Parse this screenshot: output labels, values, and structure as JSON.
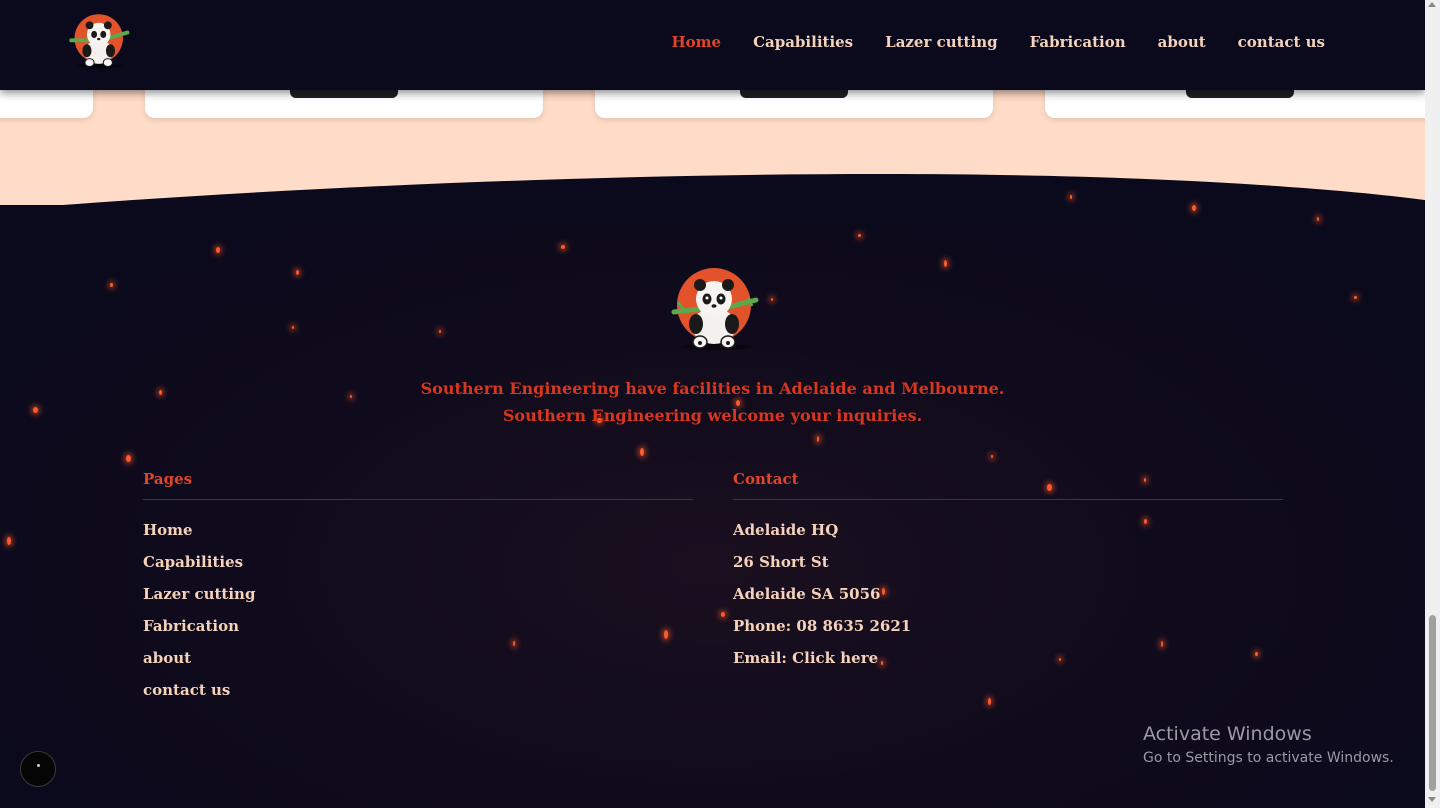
{
  "nav": {
    "items": [
      {
        "label": "Home",
        "active": true
      },
      {
        "label": "Capabilities",
        "active": false
      },
      {
        "label": "Lazer cutting",
        "active": false
      },
      {
        "label": "Fabrication",
        "active": false
      },
      {
        "label": "about",
        "active": false
      },
      {
        "label": "contact us",
        "active": false
      }
    ]
  },
  "footer": {
    "tagline": "Southern Engineering have facilities in Adelaide and Melbourne. Southern Engineering welcome your inquiries.",
    "pages": {
      "title": "Pages",
      "links": [
        "Home",
        "Capabilities",
        "Lazer cutting",
        "Fabrication",
        "about",
        "contact us"
      ]
    },
    "contact": {
      "title": "Contact",
      "lines": [
        "Adelaide HQ",
        "26 Short St",
        "Adelaide SA 5056",
        "Phone: 08 8635 2621",
        "Email: Click here"
      ]
    }
  },
  "watermark": {
    "line1": "Activate Windows",
    "line2": "Go to Settings to activate Windows."
  },
  "colors": {
    "background": "#0b0a1c",
    "accent": "#e0452a",
    "text": "#f5d2bb",
    "peach": "#ffdcc7"
  },
  "icons": [
    "panda-logo-icon",
    "chat-bubble-icon"
  ]
}
